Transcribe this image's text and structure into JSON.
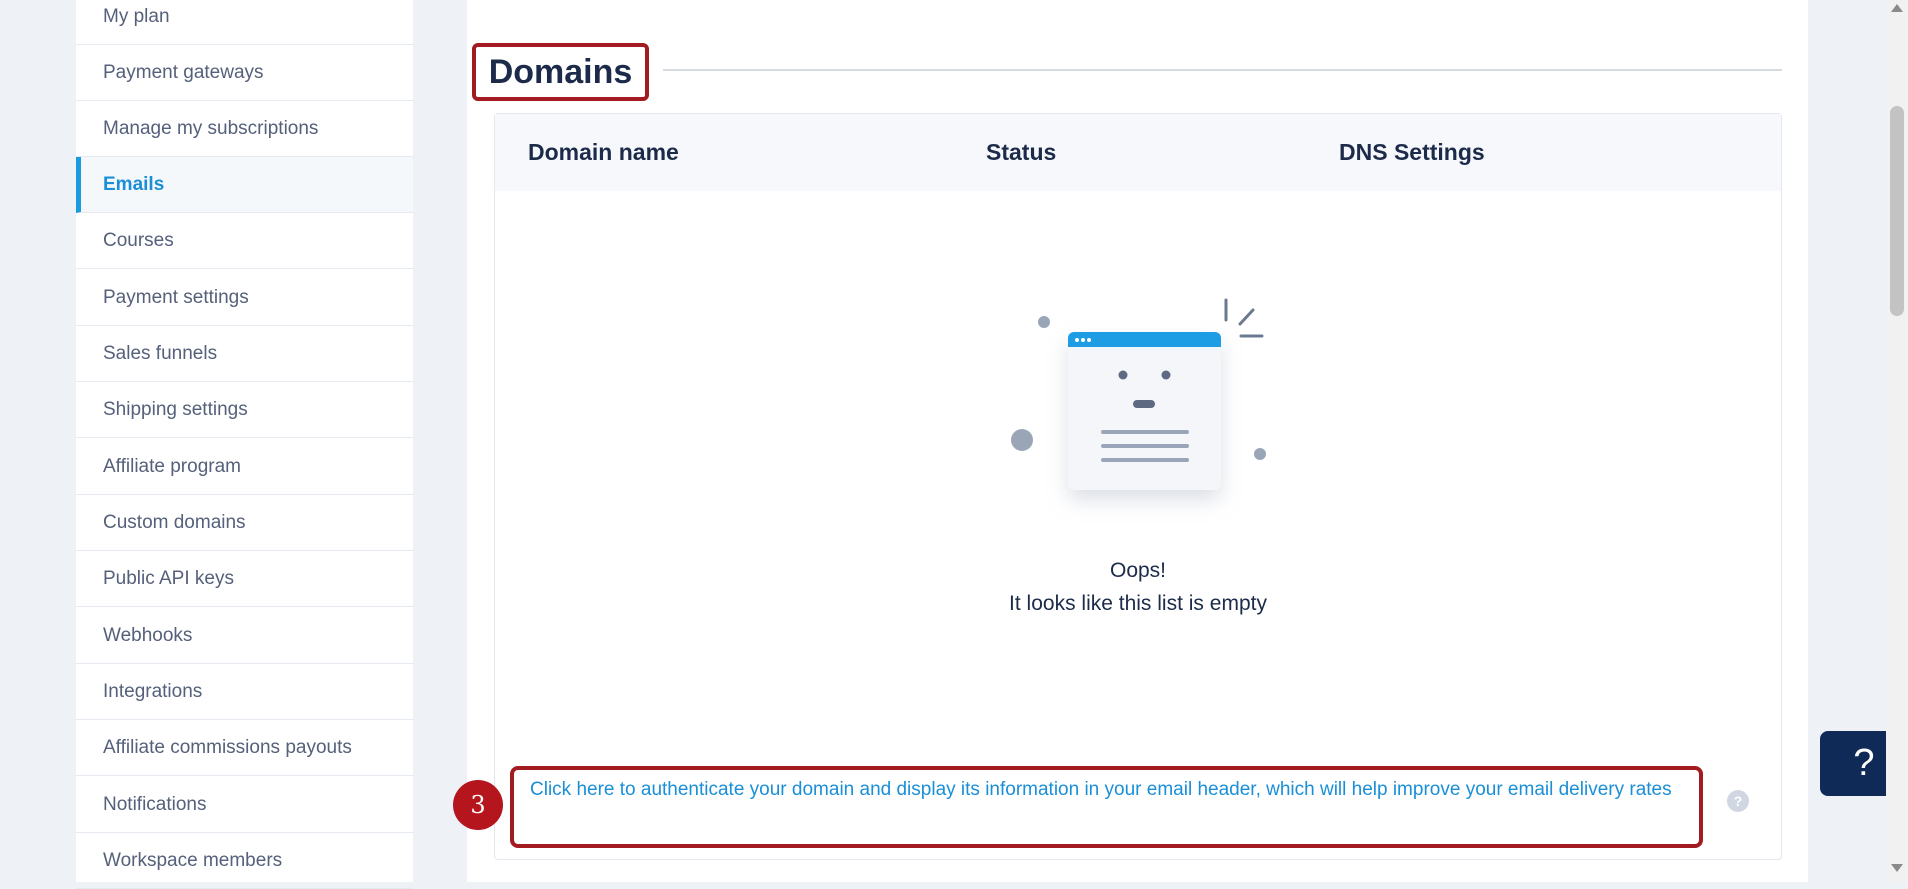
{
  "sidebar": {
    "items": [
      {
        "label": "My plan"
      },
      {
        "label": "Payment gateways"
      },
      {
        "label": "Manage my subscriptions"
      },
      {
        "label": "Emails",
        "active": true
      },
      {
        "label": "Courses"
      },
      {
        "label": "Payment settings"
      },
      {
        "label": "Sales funnels"
      },
      {
        "label": "Shipping settings"
      },
      {
        "label": "Affiliate program"
      },
      {
        "label": "Custom domains"
      },
      {
        "label": "Public API keys"
      },
      {
        "label": "Webhooks"
      },
      {
        "label": "Integrations"
      },
      {
        "label": "Affiliate commissions payouts"
      },
      {
        "label": "Notifications"
      },
      {
        "label": "Workspace members"
      }
    ]
  },
  "main": {
    "section_title": "Domains",
    "table": {
      "columns": [
        "Domain name",
        "Status",
        "DNS Settings"
      ]
    },
    "empty_state": {
      "line1": "Oops!",
      "line2": "It looks like this list is empty"
    },
    "auth_link": "Click here to authenticate your domain and display its information in your email header, which will help improve your email delivery rates",
    "step_number": "3",
    "help_small": "?",
    "help_fab": "?"
  },
  "colors": {
    "accent": "#1a8fd8",
    "annotation": "#a11b20",
    "fab": "#0f2a57",
    "heading": "#1c2b4a"
  },
  "icons": {
    "empty_state": "empty-list-illustration",
    "help": "question-mark-icon"
  }
}
